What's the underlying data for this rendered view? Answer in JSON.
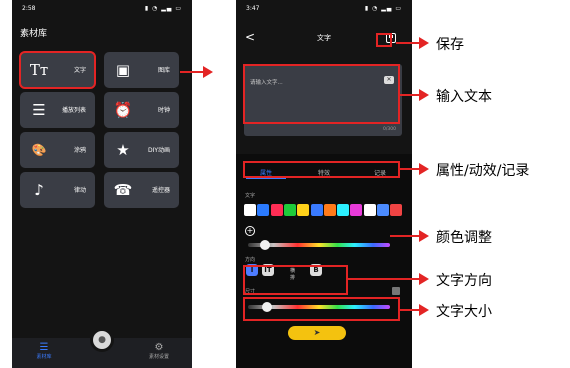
{
  "phone1": {
    "status": {
      "time": "2:58",
      "indicators": "▮ ◔ ▂▄ ▭"
    },
    "title": "素材库",
    "tiles": [
      {
        "label": "文字",
        "icon": "Tт"
      },
      {
        "label": "图库",
        "icon": "▣"
      },
      {
        "label": "播放列表",
        "icon": "☰"
      },
      {
        "label": "时钟",
        "icon": "⏰"
      },
      {
        "label": "涂鸦",
        "icon": "🎨"
      },
      {
        "label": "DIY动画",
        "icon": "★"
      },
      {
        "label": "律动",
        "icon": "♪"
      },
      {
        "label": "遥控器",
        "icon": "☎"
      }
    ],
    "nav": {
      "left_label": "素材库",
      "right_label": "素材设置"
    }
  },
  "phone2": {
    "status": {
      "time": "3:47",
      "indicators": "▮ ◔ ▂▄ ▭"
    },
    "back": "<",
    "title": "文字",
    "placeholder": "请输入文字...",
    "clear": "✕",
    "counter": "0/300",
    "tabs": [
      "属性",
      "特效",
      "记录"
    ],
    "text_label": "文字",
    "swatch_colors": [
      "#ffffff",
      "#2b7bff",
      "#ff2d55",
      "#1ecb3a",
      "#ffd21a",
      "#3a7bff",
      "#ff7a1a",
      "#2cf0ff",
      "#e83bd9",
      "#ffffff",
      "#4b8bff",
      "#f04444"
    ],
    "direction_label": "方向",
    "directions": [
      "I",
      "IT",
      "B"
    ],
    "direction_text": "横排",
    "size_label": "尺寸",
    "send_icon": "➤"
  },
  "annotations": [
    {
      "text": "保存"
    },
    {
      "text": "输入文本"
    },
    {
      "text": "属性/动效/记录"
    },
    {
      "text": "颜色调整"
    },
    {
      "text": "文字方向"
    },
    {
      "text": "文字大小"
    }
  ]
}
